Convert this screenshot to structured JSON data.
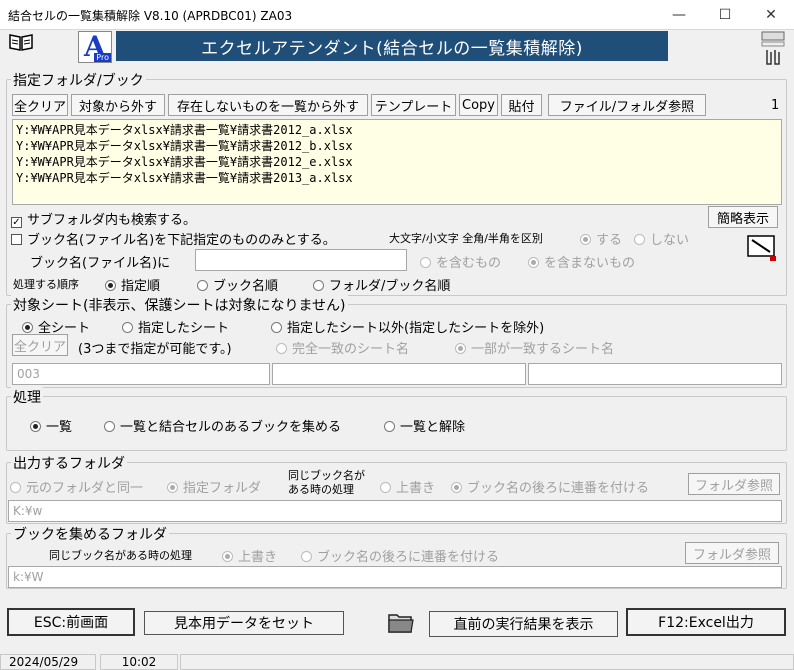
{
  "window": {
    "title": "結合セルの一覧集積解除 V8.10 (APRDBC01)  ZA03",
    "min": "—",
    "max": "☐",
    "close": "✕"
  },
  "header": {
    "banner": "エクセルアテンダント(結合セルの一覧集積解除)",
    "logo_letter": "A",
    "logo_sub": "Pro"
  },
  "folder_section": {
    "title": "指定フォルダ/ブック",
    "buttons": [
      "全クリア",
      "対象から外す",
      "存在しないものを一覧から外す",
      "テンプレート",
      "Copy",
      "貼付",
      "ファイル/フォルダ参照"
    ],
    "count": "1",
    "paths": [
      "Y:¥W¥APR見本データxlsx¥請求書一覧¥請求書2012_a.xlsx",
      "Y:¥W¥APR見本データxlsx¥請求書一覧¥請求書2012_b.xlsx",
      "Y:¥W¥APR見本データxlsx¥請求書一覧¥請求書2012_e.xlsx",
      "Y:¥W¥APR見本データxlsx¥請求書一覧¥請求書2013_a.xlsx"
    ],
    "subfolder_label": "サブフォルダ内も検索する。",
    "brief_button": "簡略表示",
    "bookname_only_label": "ブック名(ファイル名)を下記指定のもののみとする。",
    "case_label": "大文字/小文字 全角/半角を区別",
    "case_yes": "する",
    "case_no": "しない",
    "bookname_label": "ブック名(ファイル名)に",
    "bookname_value": "",
    "include_label": "を含むもの",
    "exclude_label": "を含まないもの",
    "order_label": "処理する順序",
    "order_options": [
      "指定順",
      "ブック名順",
      "フォルダ/ブック名順"
    ]
  },
  "sheet_section": {
    "title": "対象シート(非表示、保護シートは対象になりません)",
    "options": [
      "全シート",
      "指定したシート",
      "指定したシート以外(指定したシートを除外)"
    ],
    "clear_button": "全クリア",
    "note": "(3つまで指定が可能です。)",
    "match_full": "完全一致のシート名",
    "match_part": "一部が一致するシート名",
    "fields": [
      "003",
      "",
      ""
    ]
  },
  "process_section": {
    "title": "処理",
    "options": [
      "一覧",
      "一覧と結合セルのあるブックを集める",
      "一覧と解除"
    ]
  },
  "output_section": {
    "title": "出力するフォルダ",
    "same_folder": "元のフォルダと同一",
    "specified_folder": "指定フォルダ",
    "same_name_label_1": "同じブック名が",
    "same_name_label_2": "ある時の処理",
    "overwrite": "上書き",
    "append_seq": "ブック名の後ろに連番を付ける",
    "browse_button": "フォルダ参照",
    "path": "K:¥w"
  },
  "collect_section": {
    "title": "ブックを集めるフォルダ",
    "same_name_label": "同じブック名がある時の処理",
    "overwrite": "上書き",
    "append_seq": "ブック名の後ろに連番を付ける",
    "browse_button": "フォルダ参照",
    "path": "k:¥W"
  },
  "footer": {
    "esc_button": "ESC:前画面",
    "sample_button": "見本用データをセット",
    "result_button": "直前の実行結果を表示",
    "f12_button": "F12:Excel出力",
    "date": "2024/05/29",
    "time": "10:02"
  }
}
